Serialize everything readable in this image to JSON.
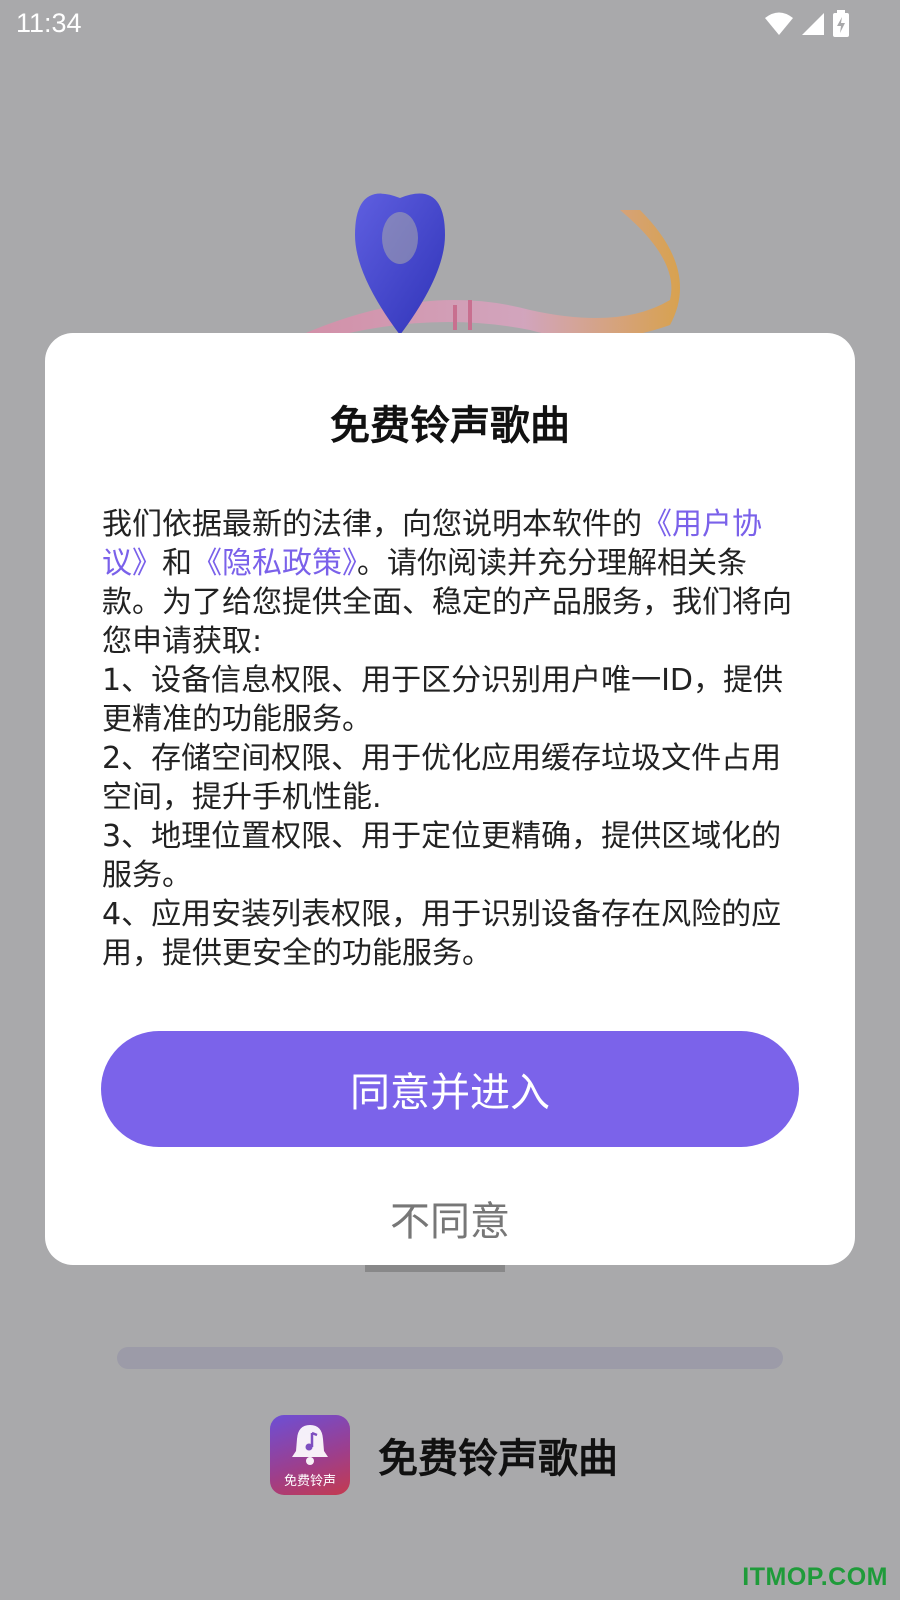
{
  "status_bar": {
    "time": "11:34"
  },
  "background": {
    "app_name": "免费铃声歌曲",
    "icon_label": "免费铃声",
    "icon": "bell-music-icon"
  },
  "dialog": {
    "title": "免费铃声歌曲",
    "intro_part1": "我们依据最新的法律，向您说明本软件的",
    "user_agreement_link": "《用户协议》",
    "and_text": "和",
    "privacy_policy_link": "《隐私政策》",
    "intro_part2": "。请你阅读并充分理解相关条款。为了给您提供全面、稳定的产品服务，我们将向您申请获取:",
    "items": [
      "1、设备信息权限、用于区分识别用户唯一ID，提供更精准的功能服务。",
      "2、存储空间权限、用于优化应用缓存垃圾文件占用空间，提升手机性能.",
      "3、地理位置权限、用于定位更精确，提供区域化的服务。",
      "4、应用安装列表权限，用于识别设备存在风险的应用，提供更安全的功能服务。"
    ],
    "agree_label": "同意并进入",
    "disagree_label": "不同意"
  },
  "watermark": "ITMOP.COM",
  "colors": {
    "accent": "#7b63ea",
    "link": "#7a61ea",
    "overlay": "#a9a9ab"
  }
}
